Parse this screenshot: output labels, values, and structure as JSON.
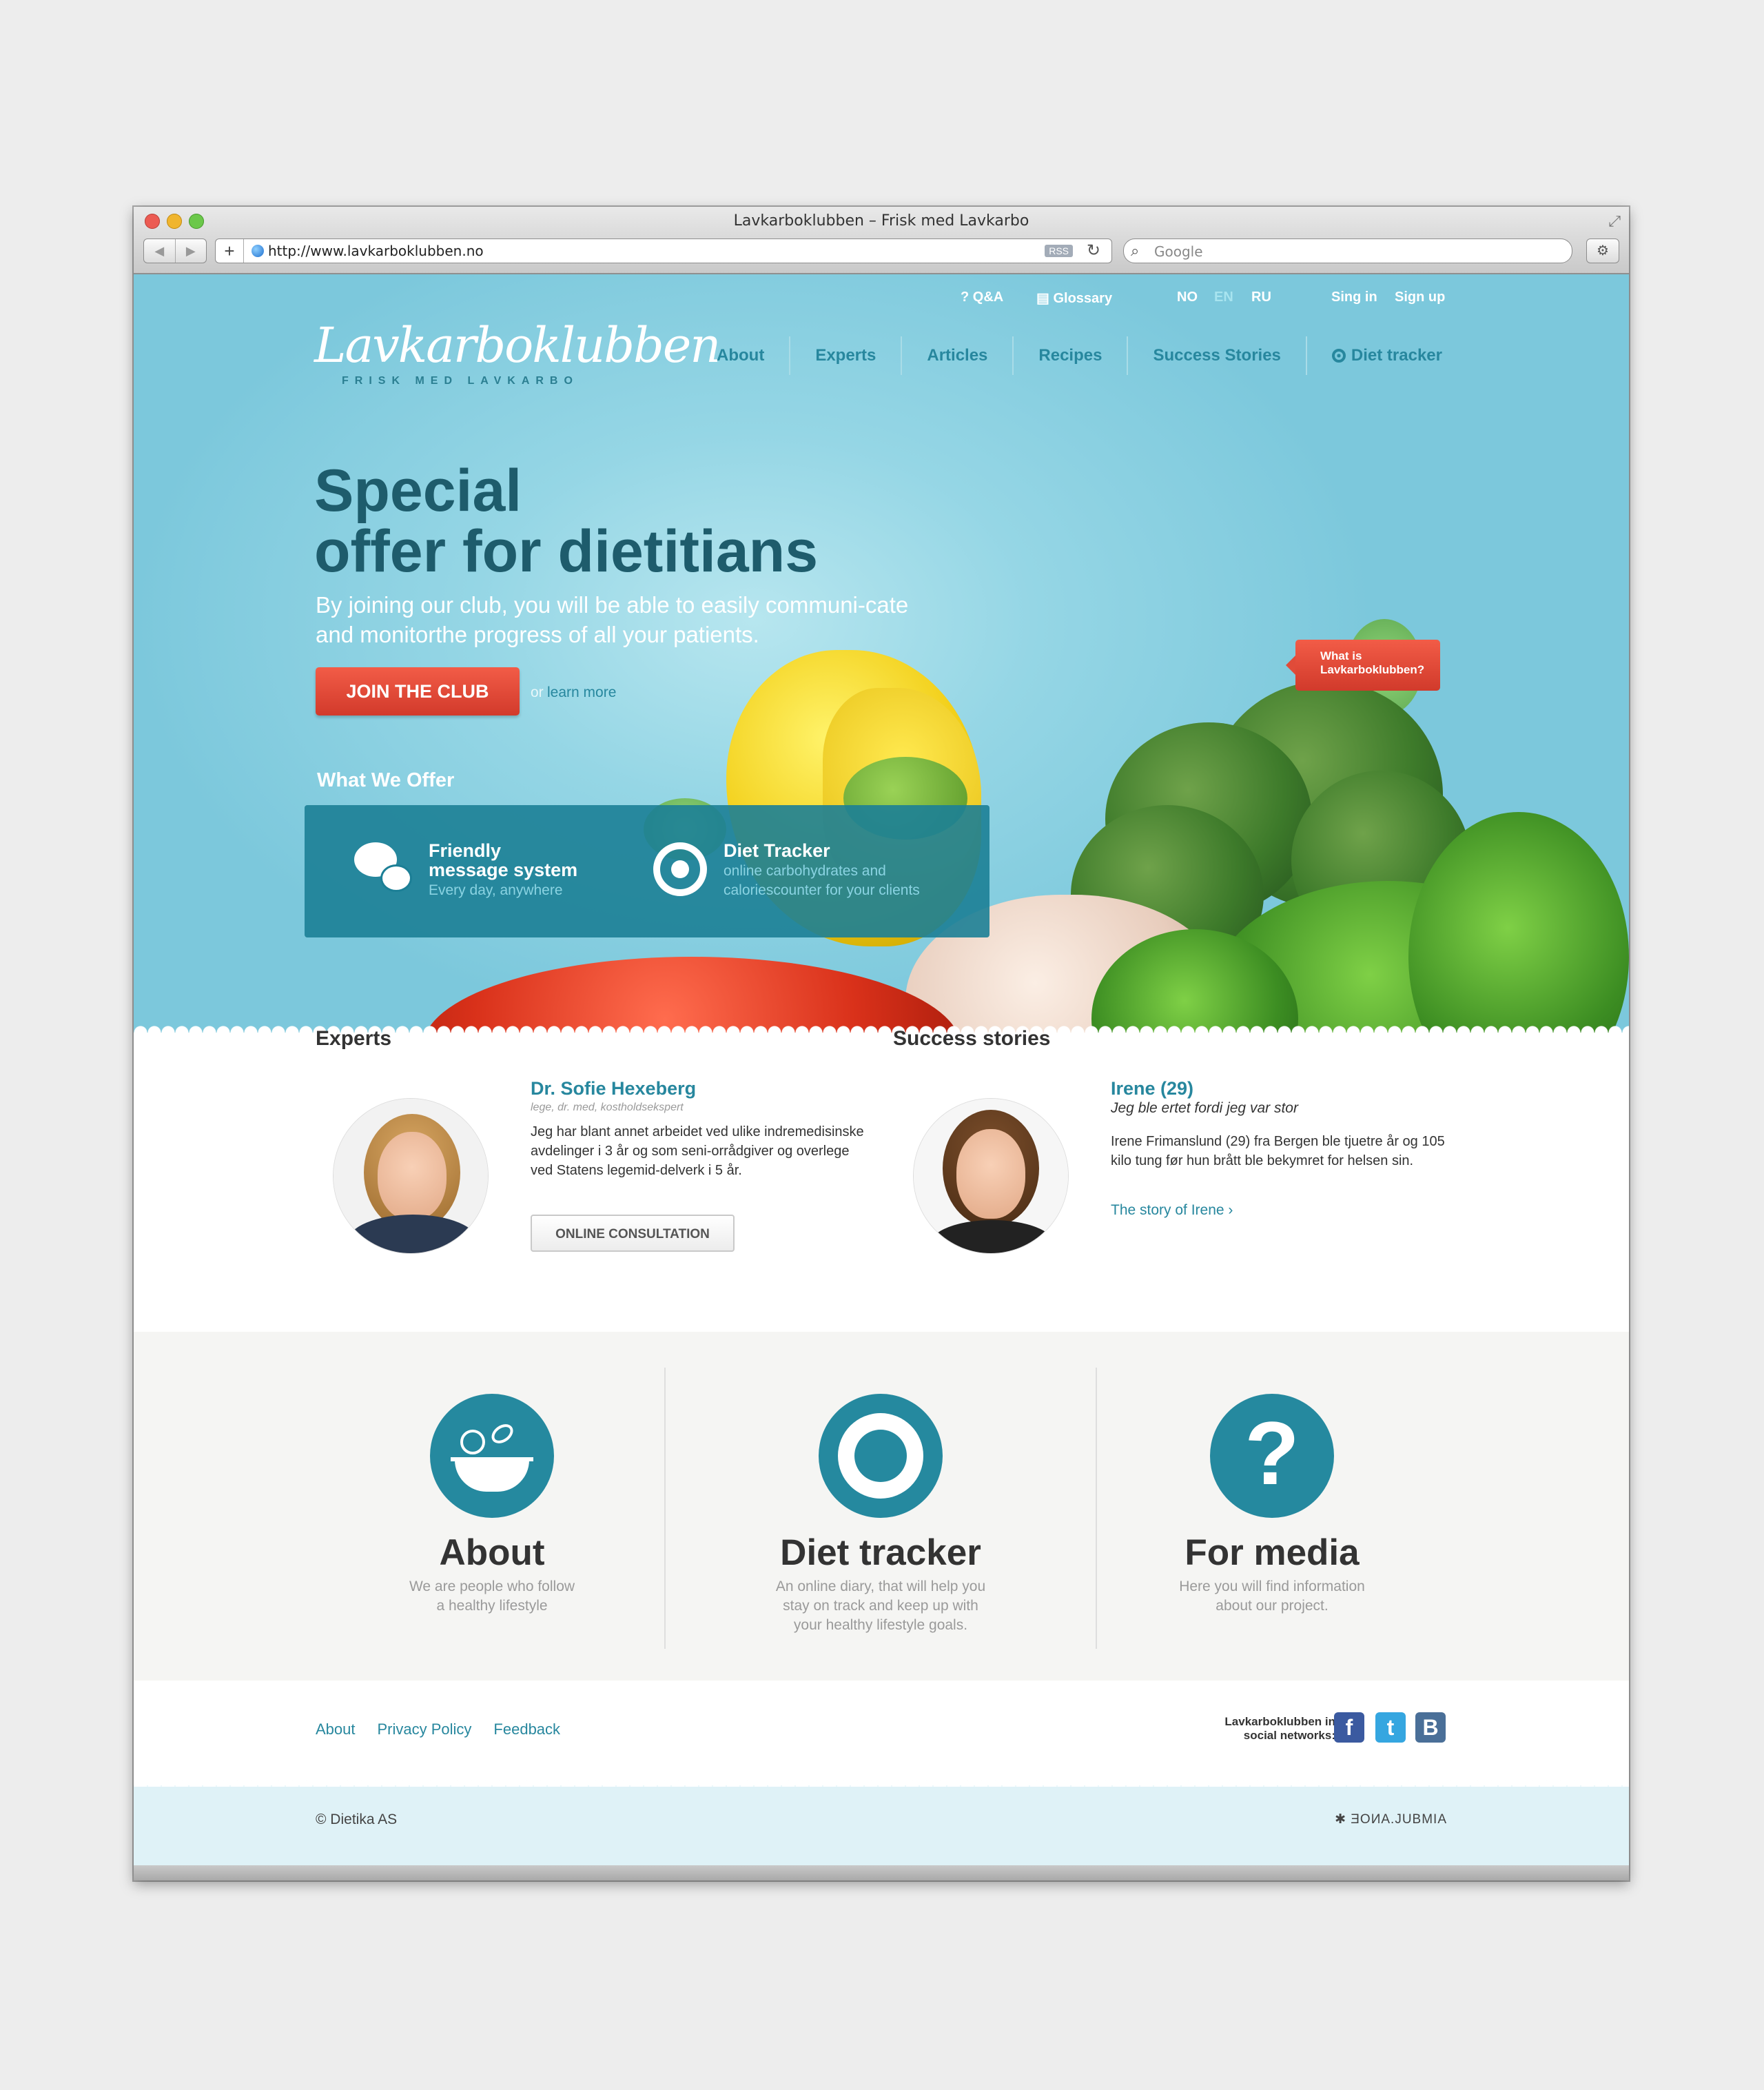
{
  "window": {
    "title": "Lavkarboklubben – Frisk med Lavkarbo",
    "url": "http://www.lavkarboklubben.no",
    "rss_label": "RSS",
    "search_placeholder": "Google"
  },
  "top_links": {
    "qa": "Q&A",
    "glossary": "Glossary",
    "lang_no": "NO",
    "lang_en": "EN",
    "lang_ru": "RU",
    "sign_in": "Sing in",
    "sign_up": "Sign up"
  },
  "logo": {
    "name": "Lavkarboklubben",
    "tagline": "FRISK MED LAVKARBO"
  },
  "nav": [
    "About",
    "Experts",
    "Articles",
    "Recipes",
    "Success Stories",
    "Diet tracker"
  ],
  "hero": {
    "title_line1": "Special",
    "title_line2": "offer for dietitians",
    "subtitle": "By joining our club, you will be able to easily communi-cate and monitorthe progress of all your patients.",
    "join_button": "JOIN THE CLUB",
    "or": "or",
    "learn_more": "learn more",
    "what_is_line1": "What is",
    "what_is_line2": "Lavkarboklubben?"
  },
  "offer": {
    "label": "What We Offer",
    "items": [
      {
        "title_line1": "Friendly",
        "title_line2": "message system",
        "desc": "Every day, anywhere"
      },
      {
        "title_line1": "Diet Tracker",
        "desc_line1": "online carbohydrates and",
        "desc_line2": "caloriescounter for your clients"
      }
    ]
  },
  "experts": {
    "heading": "Experts",
    "name": "Dr. Sofie Hexeberg",
    "role": "lege, dr. med, kostholdsekspert",
    "text": "Jeg har blant annet arbeidet ved ulike indremedisinske avdelinger i 3 år og som seni-orrådgiver og overlege ved Statens legemid-delverk i 5 år.",
    "button": "ONLINE CONSULTATION"
  },
  "stories": {
    "heading": "Success stories",
    "name": "Irene (29)",
    "quote": "Jeg ble ertet fordi jeg var stor",
    "text": "Irene Frimanslund (29) fra Bergen ble tjuetre år og 105 kilo tung før hun brått ble bekymret  for helsen sin.",
    "link": "The story of Irene ›"
  },
  "features": [
    {
      "title": "About",
      "text_line1": "We are people who follow",
      "text_line2": "a healthy lifestyle"
    },
    {
      "title": "Diet tracker",
      "text_line1": "An online diary, that will help you",
      "text_line2": "stay on track and keep up with",
      "text_line3": "your healthy lifestyle goals."
    },
    {
      "title": "For media",
      "text_line1": "Here you will find information",
      "text_line2": "about our project."
    }
  ],
  "footer": {
    "links": [
      "About",
      "Privacy Policy",
      "Feedback"
    ],
    "social_line1": "Lavkarboklubben in",
    "social_line2": "social networks:",
    "copyright": "© Dietika AS",
    "credit": "✱ ƎOИA.JUBMIA"
  },
  "colors": {
    "accent": "#27879e",
    "hero_bg": "#8fd3e3",
    "cta_red": "#e04b39",
    "offer_box": "#1c7f96"
  }
}
